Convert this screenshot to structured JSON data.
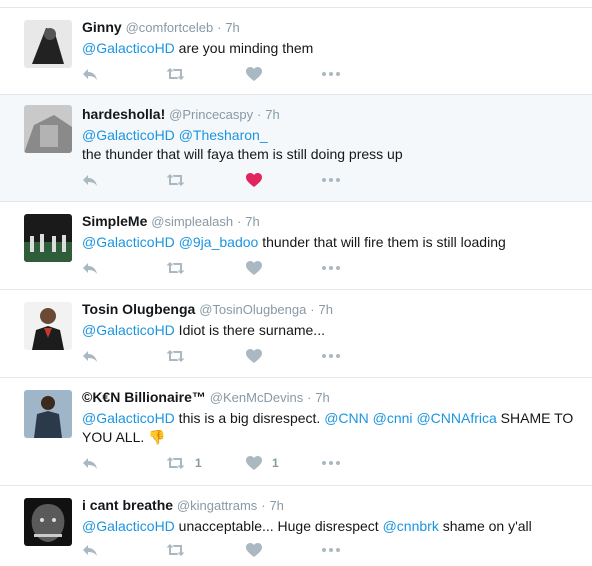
{
  "colors": {
    "mention": "#1b95e0",
    "muted": "#8899a6",
    "like_active": "#e0245e",
    "highlight_bg": "#f5f8fa"
  },
  "tweets": [
    {
      "name": "Ginny",
      "handle": "@comfortceleb",
      "sep": "·",
      "time": "7h",
      "t1": "@GalacticoHD",
      "t2": " are you minding them",
      "retweets": "",
      "likes": "",
      "liked": false
    },
    {
      "name": "hardesholla!",
      "handle": "@Princecaspy",
      "sep": "·",
      "time": "7h",
      "t1": "@GalacticoHD",
      "t2": " ",
      "t3": "@Thesharon_",
      "t4": " the thunder that will faya them is still doing press up",
      "retweets": "",
      "likes": "",
      "liked": true
    },
    {
      "name": "SimpleMe",
      "handle": "@simplealash",
      "sep": "·",
      "time": "7h",
      "t1": "@GalacticoHD",
      "t2": " ",
      "t3": "@9ja_badoo",
      "t4": " thunder that will fire them is still loading",
      "retweets": "",
      "likes": "",
      "liked": false
    },
    {
      "name": "Tosin Olugbenga",
      "handle": "@TosinOlugbenga",
      "sep": "·",
      "time": "7h",
      "t1": "@GalacticoHD",
      "t2": " Idiot is there surname...",
      "retweets": "",
      "likes": "",
      "liked": false
    },
    {
      "name": "©K€N Billionaire™",
      "handle": "@KenMcDevins",
      "sep": "·",
      "time": "7h",
      "t1": "@GalacticoHD",
      "t2": " this is a big disrespect. ",
      "t3": "@CNN",
      "t4": " ",
      "t5": "@cnni",
      "t6": " ",
      "t7": "@CNNAfrica",
      "t8": " SHAME TO YOU ALL. ",
      "emoji": "👎",
      "retweets": "1",
      "likes": "1",
      "liked": false
    },
    {
      "name": "i cant breathe",
      "handle": "@kingattrams",
      "sep": "·",
      "time": "7h",
      "t1": "@GalacticoHD",
      "t2": " unacceptable... Huge disrespect ",
      "t3": "@cnnbrk",
      "t4": " shame on y'all",
      "retweets": "",
      "likes": "",
      "liked": false
    }
  ]
}
